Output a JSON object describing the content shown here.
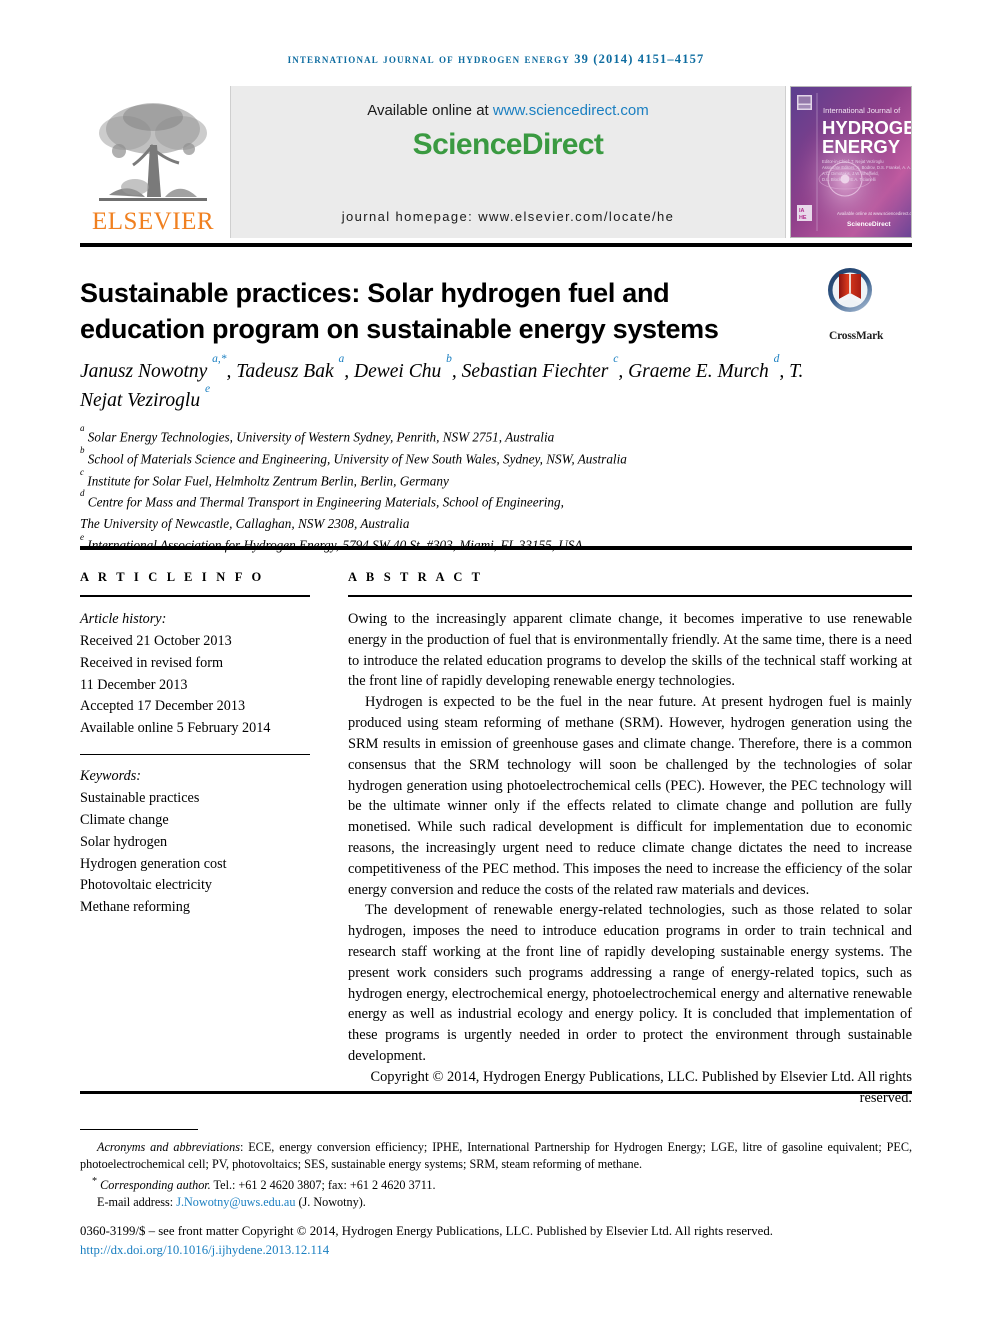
{
  "running_head": "international journal of hydrogen energy 39 (2014) 4151–4157",
  "masthead": {
    "publisher_name": "ELSEVIER",
    "publisher_logo": "elsevier-tree-logo",
    "available_prefix": "Available online at ",
    "available_url": "www.sciencedirect.com",
    "sciencedirect_logo_science": "Science",
    "sciencedirect_logo_direct": "Direct",
    "journal_homepage": "journal homepage: www.elsevier.com/locate/he",
    "cover": {
      "line1": "International Journal of",
      "line2": "HYDROGEN",
      "line3": "ENERGY",
      "badge": "IAHE",
      "footer": "ScienceDirect"
    }
  },
  "title": "Sustainable practices: Solar hydrogen fuel and education program on sustainable energy systems",
  "crossmark": {
    "label": "CrossMark",
    "icon": "crossmark-logo"
  },
  "authors_html": "Janusz Nowotny <sup>a,*</sup>, Tadeusz Bak <sup>a</sup>, Dewei Chu <sup>b</sup>, Sebastian Fiechter <sup>c</sup>, Graeme E. Murch <sup>d</sup>, T. Nejat Veziroglu <sup>e</sup>",
  "affiliations": [
    {
      "marker": "a",
      "text": "Solar Energy Technologies, University of Western Sydney, Penrith, NSW 2751, Australia"
    },
    {
      "marker": "b",
      "text": "School of Materials Science and Engineering, University of New South Wales, Sydney, NSW, Australia"
    },
    {
      "marker": "c",
      "text": "Institute for Solar Fuel, Helmholtz Zentrum Berlin, Berlin, Germany"
    },
    {
      "marker": "d",
      "text": "Centre for Mass and Thermal Transport in Engineering Materials, School of Engineering,"
    },
    {
      "marker": "",
      "text": "The University of Newcastle, Callaghan, NSW 2308, Australia"
    },
    {
      "marker": "e",
      "text": "International Association for Hydrogen Energy, 5794 SW 40 St. #303, Miami, FL 33155, USA"
    }
  ],
  "article_info": {
    "heading": "A R T I C L E  I N F O",
    "history_label": "Article history:",
    "history": [
      "Received 21 October 2013",
      "Received in revised form",
      "11 December 2013",
      "Accepted 17 December 2013",
      "Available online 5 February 2014"
    ],
    "keywords_label": "Keywords:",
    "keywords": [
      "Sustainable practices",
      "Climate change",
      "Solar hydrogen",
      "Hydrogen generation cost",
      "Photovoltaic electricity",
      "Methane reforming"
    ]
  },
  "abstract": {
    "heading": "A B S T R A C T",
    "paragraphs": [
      "Owing to the increasingly apparent climate change, it becomes imperative to use renewable energy in the production of fuel that is environmentally friendly. At the same time, there is a need to introduce the related education programs to develop the skills of the technical staff working at the front line of rapidly developing renewable energy technologies.",
      "Hydrogen is expected to be the fuel in the near future. At present hydrogen fuel is mainly produced using steam reforming of methane (SRM). However, hydrogen generation using the SRM results in emission of greenhouse gases and climate change. Therefore, there is a common consensus that the SRM technology will soon be challenged by the technologies of solar hydrogen generation using photoelectrochemical cells (PEC). However, the PEC technology will be the ultimate winner only if the effects related to climate change and pollution are fully monetised. While such radical development is difficult for implementation due to economic reasons, the increasingly urgent need to reduce climate change dictates the need to increase competitiveness of the PEC method. This imposes the need to increase the efficiency of the solar energy conversion and reduce the costs of the related raw materials and devices.",
      "The development of renewable energy-related technologies, such as those related to solar hydrogen, imposes the need to introduce education programs in order to train technical and research staff working at the front line of rapidly developing sustainable energy systems. The present work considers such programs addressing a range of energy-related topics, such as hydrogen energy, electrochemical energy, photoelectrochemical energy and alternative renewable energy as well as industrial ecology and energy policy. It is concluded that implementation of these programs is urgently needed in order to protect the environment through sustainable development."
    ],
    "copyright": "Copyright © 2014, Hydrogen Energy Publications, LLC. Published by Elsevier Ltd. All rights reserved."
  },
  "footnotes": {
    "acronyms_label": "Acronyms and abbreviations",
    "acronyms_text": ": ECE, energy conversion efficiency; IPHE, International Partnership for Hydrogen Energy; LGE, litre of gasoline equivalent; PEC, photoelectrochemical cell; PV, photovoltaics; SES, sustainable energy systems; SRM, steam reforming of methane.",
    "corresponding_marker": "*",
    "corresponding_label": "Corresponding author.",
    "corresponding_text": " Tel.: +61 2 4620 3807; fax: +61 2 4620 3711.",
    "email_label": "E-mail address:",
    "email_address": "J.Nowotny@uws.edu.au",
    "email_suffix": "(J. Nowotny).",
    "issn_line": "0360-3199/$ – see front matter Copyright © 2014, Hydrogen Energy Publications, LLC. Published by Elsevier Ltd. All rights reserved.",
    "doi": "http://dx.doi.org/10.1016/j.ijhydene.2013.12.114"
  },
  "colors": {
    "link": "#1a7fc1",
    "running_head": "#0e6ca0",
    "elsevier_orange": "#f08020",
    "sciencedirect_green": "#3a9a41",
    "panel_gray": "#ebebeb"
  }
}
